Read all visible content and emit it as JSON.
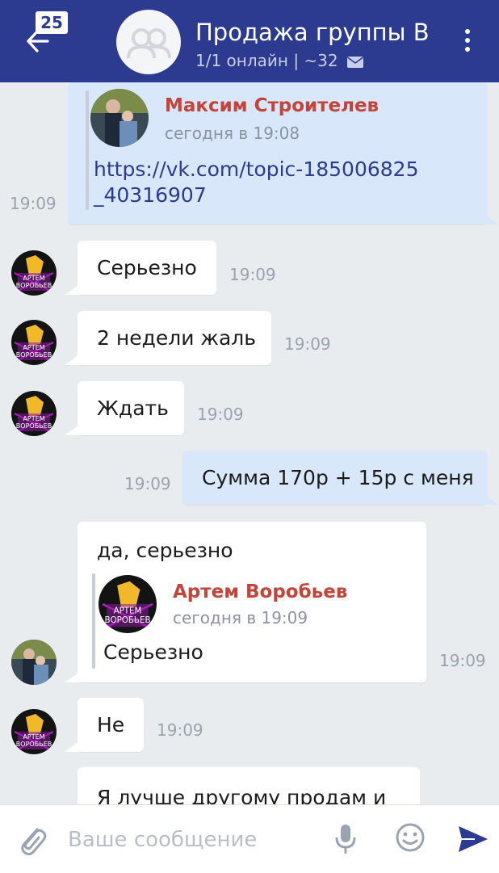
{
  "header": {
    "back_icon": "arrow-left-icon",
    "unread_badge": "25",
    "title": "Продажа группы ВК",
    "subtitle": "1/1 онлайн | ~32",
    "subtitle_icon": "envelope-icon",
    "menu_icon": "more-vertical-icon",
    "bg_color": "#2c3a8f"
  },
  "messages": [
    {
      "id": "m1",
      "direction": "outgoing",
      "forwarded_author": "Максим Строителев",
      "forwarded_date": "сегодня в 19:08",
      "link_line1": "https://vk.com/topic-185006825",
      "link_line2": "_40316907",
      "time": "19:09"
    },
    {
      "id": "m2",
      "direction": "incoming",
      "text": "Серьезно",
      "time": "19:09"
    },
    {
      "id": "m3",
      "direction": "incoming",
      "text": "2 недели жаль",
      "time": "19:09"
    },
    {
      "id": "m4",
      "direction": "incoming",
      "text": "Ждать",
      "time": "19:09"
    },
    {
      "id": "m5",
      "direction": "outgoing",
      "text": "Сумма 170р + 15р с меня",
      "time": "19:09"
    },
    {
      "id": "m6",
      "direction": "incoming",
      "text": "да, серьезно",
      "reply_author": "Артем Воробьев",
      "reply_date": "сегодня в 19:09",
      "reply_text": "Серьезно",
      "time": "19:09"
    },
    {
      "id": "m7",
      "direction": "incoming",
      "text": "Не",
      "time": "19:09"
    },
    {
      "id": "m8",
      "direction": "incoming",
      "text": "Я лучше другому продам и"
    }
  ],
  "avatar_caption_line1": "АРТЕМ",
  "avatar_caption_line2": "ВОРОБЬЕВ",
  "composer": {
    "placeholder": "Ваше сообщение",
    "attach_icon": "paperclip-icon",
    "mic_icon": "microphone-icon",
    "emoji_icon": "smiley-icon",
    "send_icon": "send-icon",
    "accent_color": "#2c3a8f"
  },
  "colors": {
    "background": "#e9ecef",
    "incoming_bubble": "#ffffff",
    "outgoing_bubble": "#d9e7fb",
    "author_name": "#c4443a",
    "time_text": "#9aa3b0"
  }
}
